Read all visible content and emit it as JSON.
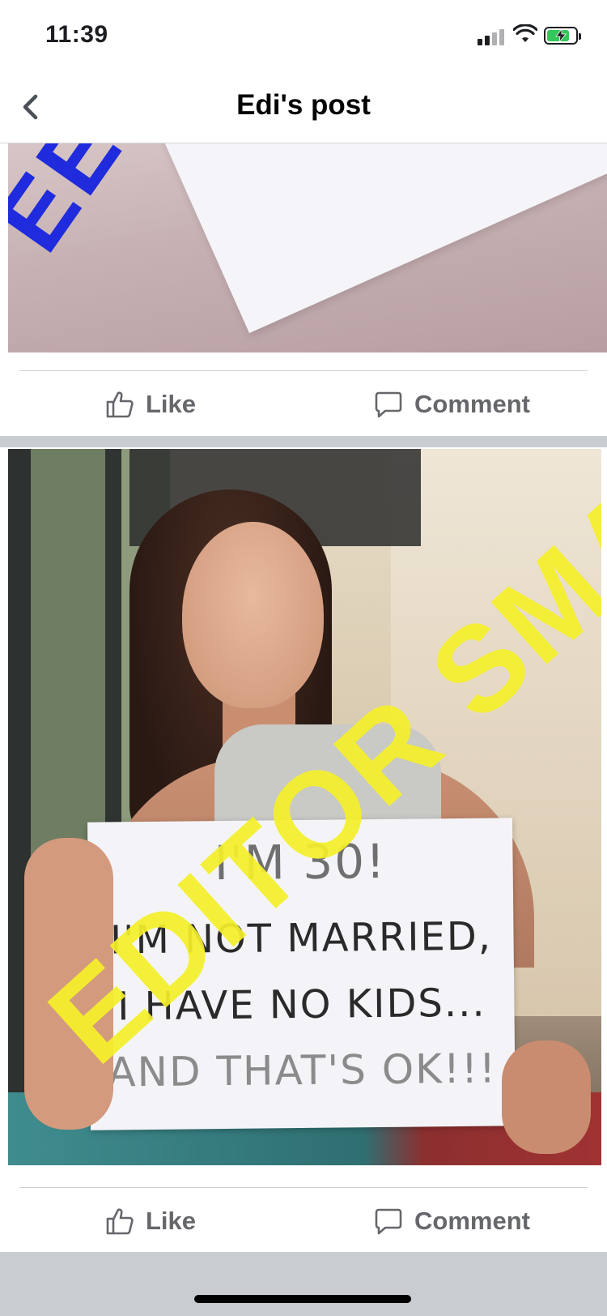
{
  "status_bar": {
    "time": "11:39",
    "battery_level": 0.8,
    "charging": true,
    "battery_color": "#34c759"
  },
  "header": {
    "back_icon": "chevron-left-icon",
    "title": "Edi's post"
  },
  "posts": [
    {
      "image_description_icon": "photo",
      "watermark_fragment": "EE",
      "watermark_color": "#1f2bdc",
      "actions": {
        "like_label": "Like",
        "comment_label": "Comment"
      }
    },
    {
      "image_description_icon": "photo",
      "sign_lines": [
        "I'M 30!",
        "I'M NOT MARRIED,",
        "I HAVE NO KIDS...",
        "AND THAT'S OK!!!"
      ],
      "watermark": "EDITOR SMART",
      "watermark_color": "#f5f02a",
      "actions": {
        "like_label": "Like",
        "comment_label": "Comment"
      }
    }
  ],
  "icons": {
    "like": "thumbs-up-icon",
    "comment": "speech-bubble-icon"
  },
  "colors": {
    "action_text": "#65676b",
    "separator": "#c9ccd1"
  }
}
